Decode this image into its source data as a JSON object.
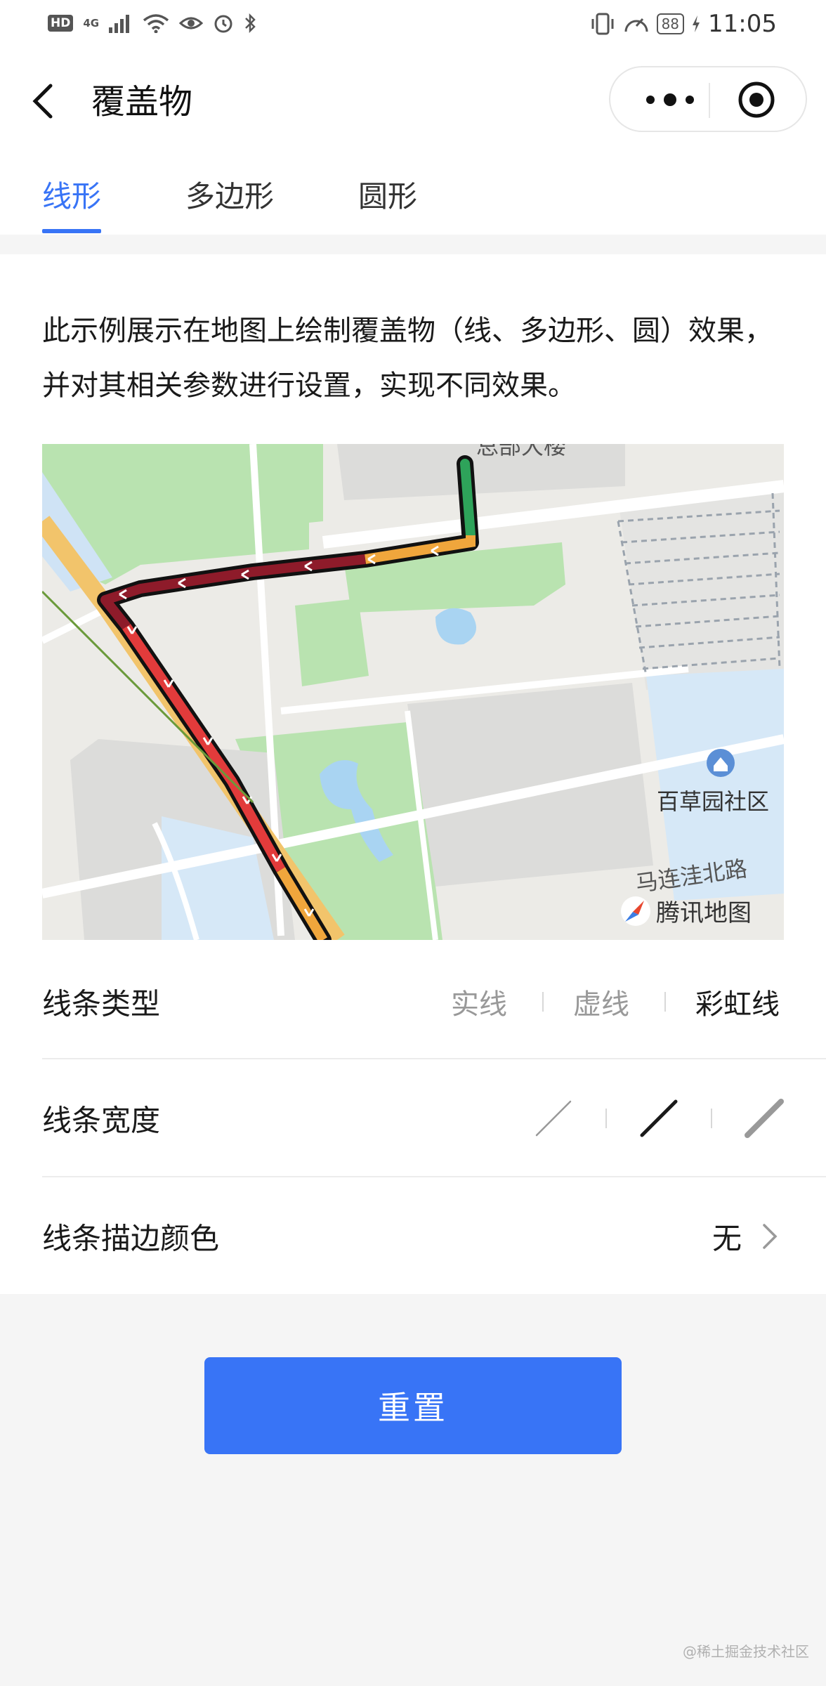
{
  "status_bar": {
    "hd_badge": "HD",
    "network": "4G",
    "battery": "88",
    "time": "11:05"
  },
  "nav": {
    "title": "覆盖物"
  },
  "tabs": [
    {
      "label": "线形",
      "active": true
    },
    {
      "label": "多边形",
      "active": false
    },
    {
      "label": "圆形",
      "active": false
    }
  ],
  "description": "此示例展示在地图上绘制覆盖物（线、多边形、圆）效果，并对其相关参数进行设置，实现不同效果。",
  "map": {
    "labels": {
      "building": "总部大楼",
      "community": "百草园社区",
      "road": "马连洼北路",
      "brand": "腾讯地图"
    }
  },
  "settings": {
    "line_type": {
      "label": "线条类型",
      "options": [
        "实线",
        "虚线",
        "彩虹线"
      ],
      "selected": "彩虹线"
    },
    "line_width": {
      "label": "线条宽度",
      "options": [
        "thin",
        "medium",
        "thick"
      ],
      "selected": "medium"
    },
    "border_color": {
      "label": "线条描边颜色",
      "value": "无"
    }
  },
  "reset_button": "重置",
  "watermark": "@稀土掘金技术社区",
  "colors": {
    "accent": "#3874f6",
    "rainbow": [
      "#2ea35a",
      "#f0a63c",
      "#8e1b2a",
      "#e23b3b"
    ]
  }
}
